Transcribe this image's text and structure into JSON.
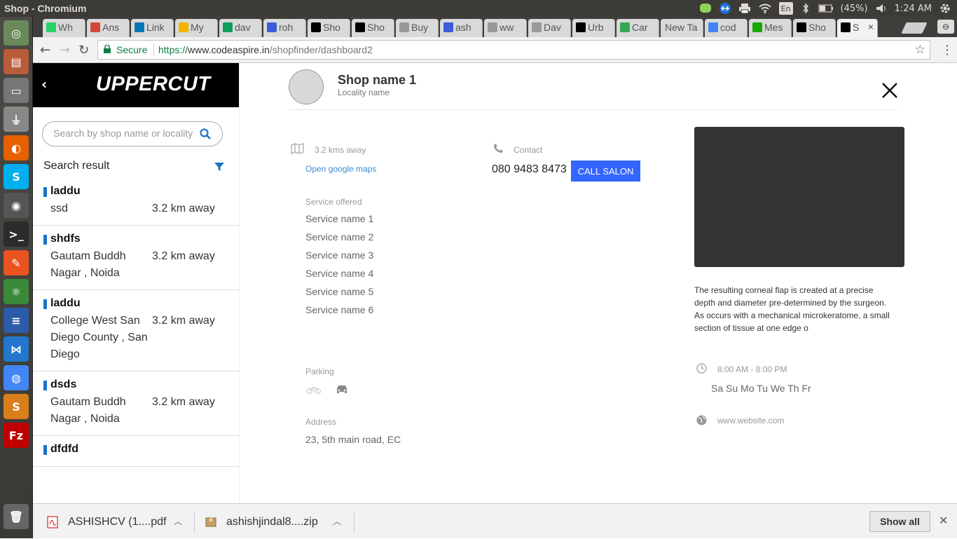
{
  "window": {
    "title": "Shop - Chromium"
  },
  "tray": {
    "lang": "En",
    "battery": "(45%)",
    "time": "1:24 AM"
  },
  "tabs": [
    {
      "label": "Wh",
      "color": "#25d366"
    },
    {
      "label": "Ans",
      "color": "#d44638"
    },
    {
      "label": "Link",
      "color": "#0077b5"
    },
    {
      "label": "My",
      "color": "#f4b400"
    },
    {
      "label": "dav",
      "color": "#0f9d58"
    },
    {
      "label": "roh",
      "color": "#3b5bdb"
    },
    {
      "label": "Sho",
      "color": "#000000"
    },
    {
      "label": "Sho",
      "color": "#000000"
    },
    {
      "label": "Buy",
      "color": "#999999"
    },
    {
      "label": "ash",
      "color": "#3b5bdb"
    },
    {
      "label": "ww",
      "color": "#999999"
    },
    {
      "label": "Dav",
      "color": "#999999"
    },
    {
      "label": "Urb",
      "color": "#000000"
    },
    {
      "label": "Car",
      "color": "#34a853"
    },
    {
      "label": "New Ta",
      "color": ""
    },
    {
      "label": "cod",
      "color": "#4285f4"
    },
    {
      "label": "Mes",
      "color": "#14a800"
    },
    {
      "label": "Sho",
      "color": "#000000"
    },
    {
      "label": "S",
      "color": "#000000"
    }
  ],
  "address": {
    "secure_label": "Secure",
    "scheme": "https://",
    "host": "www.codeaspire.in",
    "path": "/shopfinder/dashboard2"
  },
  "sidebar": {
    "brand": "UPPERCUT",
    "search_placeholder": "Search by shop name or locality",
    "result_heading": "Search result",
    "items": [
      {
        "name": "laddu",
        "location": "ssd",
        "distance": "3.2 km away"
      },
      {
        "name": "shdfs",
        "location": "Gautam Buddh Nagar , Noida",
        "distance": "3.2 km away"
      },
      {
        "name": "laddu",
        "location": "College West San Diego County , San Diego",
        "distance": "3.2 km away"
      },
      {
        "name": "dsds",
        "location": "Gautam Buddh Nagar , Noida",
        "distance": "3.2 km away"
      },
      {
        "name": "dfdfd",
        "location": "",
        "distance": ""
      }
    ]
  },
  "detail": {
    "shop_name": "Shop name 1",
    "locality": "Locality name",
    "distance": "3.2 kms away",
    "maps_link": "Open google maps",
    "contact_label": "Contact",
    "phone": "080 9483 8473",
    "call_button": "CALL SALON",
    "services_label": "Service offered",
    "services": [
      "Service name 1",
      "Service name 2",
      "Service name 3",
      "Service name 4",
      "Service name 5",
      "Service name 6"
    ],
    "parking_label": "Parking",
    "address_label": "Address",
    "address": "23, 5th main road, EC",
    "description": "The resulting corneal flap is created at a precise depth and diameter pre-determined by the surgeon. As occurs with a mechanical microkeratome, a small section of tissue at one edge o",
    "hours": "8:00 AM - 8:00 PM",
    "days": "Sa Su Mo Tu We Th Fr",
    "website": "www.website.com"
  },
  "downloads": {
    "items": [
      {
        "name": "ASHISHCV (1....pdf",
        "icon": "pdf-icon"
      },
      {
        "name": "ashishjindal8....zip",
        "icon": "archive-icon"
      }
    ],
    "show_all": "Show all"
  },
  "colors": {
    "accent": "#3366ff",
    "brand_bg": "#000000",
    "link": "#3b8ad8",
    "secure": "#0b8043"
  }
}
